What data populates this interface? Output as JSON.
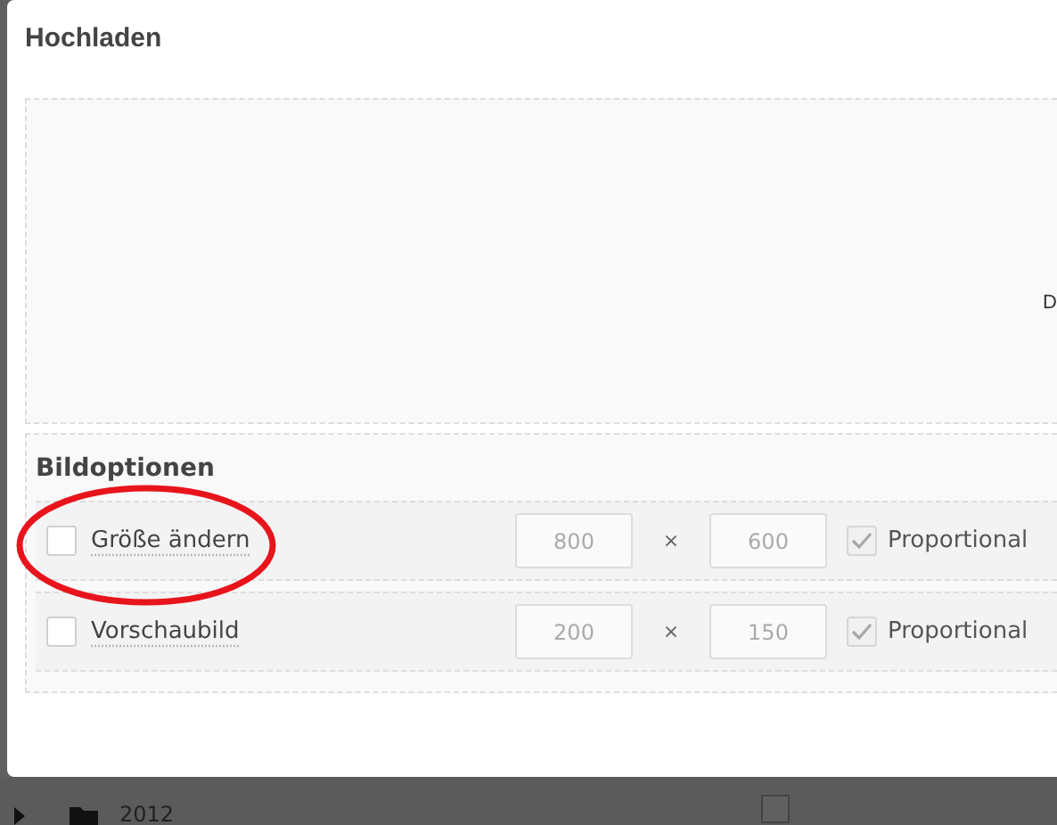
{
  "dialog": {
    "title": "Hochladen"
  },
  "dropzone": {
    "text": "D"
  },
  "image_options": {
    "title": "Bildoptionen",
    "rows": [
      {
        "label": "Größe ändern",
        "checked": false,
        "width": {
          "placeholder": "800"
        },
        "separator": "×",
        "height": {
          "placeholder": "600"
        },
        "proportional": {
          "label": "Proportional",
          "checked": true,
          "disabled": true
        }
      },
      {
        "label": "Vorschaubild",
        "checked": false,
        "width": {
          "placeholder": "200"
        },
        "separator": "×",
        "height": {
          "placeholder": "150"
        },
        "proportional": {
          "label": "Proportional",
          "checked": true,
          "disabled": true
        }
      }
    ]
  },
  "background": {
    "folder": {
      "label": "2012"
    },
    "checkbox": {
      "checked": false
    }
  }
}
